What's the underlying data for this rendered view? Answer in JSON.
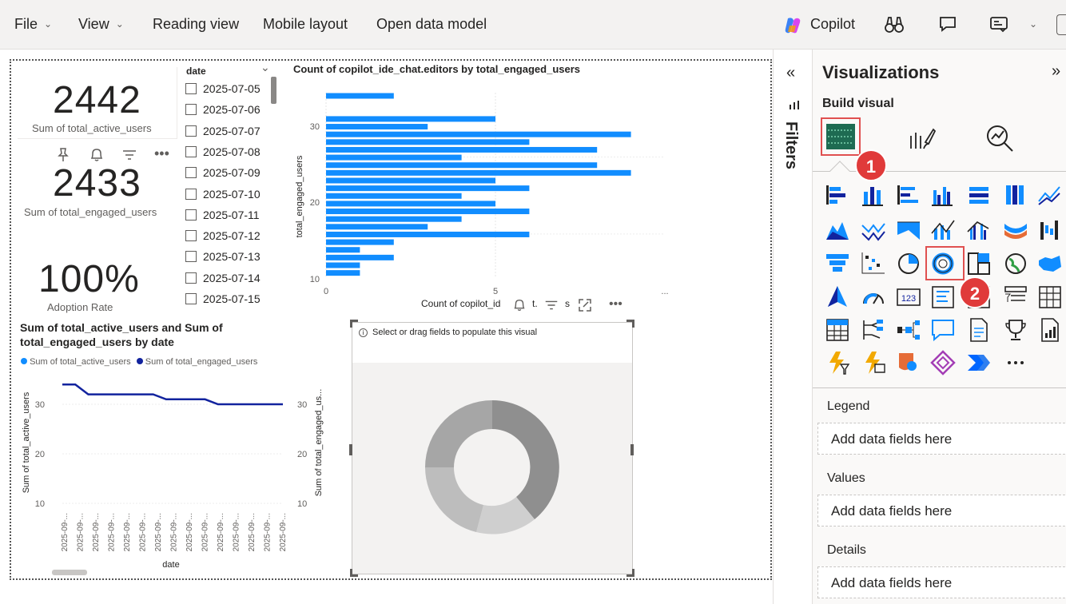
{
  "menu": {
    "file": "File",
    "view": "View",
    "reading_view": "Reading view",
    "mobile_layout": "Mobile layout",
    "open_data_model": "Open data model",
    "copilot": "Copilot"
  },
  "kpis": [
    {
      "value": "2442",
      "label": "Sum of total_active_users"
    },
    {
      "value": "2433",
      "label": "Sum of total_engaged_users"
    },
    {
      "value": "100%",
      "label": "Adoption Rate"
    }
  ],
  "slicer": {
    "header": "date",
    "items": [
      "2025-07-05",
      "2025-07-06",
      "2025-07-07",
      "2025-07-08",
      "2025-07-09",
      "2025-07-10",
      "2025-07-11",
      "2025-07-12",
      "2025-07-13",
      "2025-07-14",
      "2025-07-15"
    ]
  },
  "bar_visual": {
    "title": "Count of copilot_ide_chat.editors by total_engaged_users",
    "ylabel": "total_engaged_users",
    "xlabel_partial": "Count of copilot_id",
    "header_text_1": "t.",
    "header_text_2": "s",
    "yticks": [
      "30",
      "20",
      "10"
    ],
    "xticks": [
      "0",
      "5",
      "..."
    ]
  },
  "line_visual": {
    "title_line1": "Sum of total_active_users and Sum of",
    "title_line2": "total_engaged_users by date",
    "legend1": "Sum of total_active_users",
    "legend2": "Sum of total_engaged_users",
    "ylabel_left": "Sum of total_active_users",
    "ylabel_right": "Sum of total_engaged_us...",
    "yticks": [
      "30",
      "20",
      "10"
    ],
    "xlabel": "date",
    "xtick": "2025-09-..."
  },
  "donut_visual": {
    "hint": "Select or drag fields to populate this visual"
  },
  "filters": {
    "label": "Filters"
  },
  "viz_pane": {
    "title": "Visualizations",
    "build_visual": "Build visual",
    "wells": [
      {
        "title": "Legend",
        "placeholder": "Add data fields here"
      },
      {
        "title": "Values",
        "placeholder": "Add data fields here"
      },
      {
        "title": "Details",
        "placeholder": "Add data fields here"
      }
    ],
    "badge1": "1",
    "badge2": "2",
    "more": "..."
  },
  "colors": {
    "accent": "#118dff",
    "dark_series": "#12239e",
    "badge": "#e03a3a"
  },
  "chart_data": [
    {
      "type": "bar",
      "title": "Count of copilot_ide_chat.editors by total_engaged_users",
      "ylabel": "total_engaged_users",
      "xlabel": "Count of copilot_id",
      "y": [
        34,
        32,
        31,
        30,
        29,
        28,
        27,
        26,
        25,
        24,
        23,
        22,
        21,
        20,
        19,
        18,
        17,
        16,
        15,
        14,
        13,
        12,
        11
      ],
      "values": [
        2,
        0,
        5,
        3,
        9,
        6,
        8,
        4,
        8,
        9,
        5,
        6,
        4,
        5,
        6,
        4,
        3,
        6,
        2,
        1,
        2,
        1,
        1
      ],
      "xlim": [
        0,
        10
      ]
    },
    {
      "type": "line",
      "title": "Sum of total_active_users and Sum of total_engaged_users by date",
      "xlabel": "date",
      "ylabel": "Sum of total_active_users",
      "ylim": [
        10,
        35
      ],
      "series": [
        {
          "name": "Sum of total_engaged_users",
          "values": [
            34,
            34,
            32,
            32,
            32,
            32,
            32,
            32,
            31,
            31,
            31,
            31,
            30,
            30,
            30,
            30,
            30,
            30
          ]
        }
      ]
    }
  ]
}
